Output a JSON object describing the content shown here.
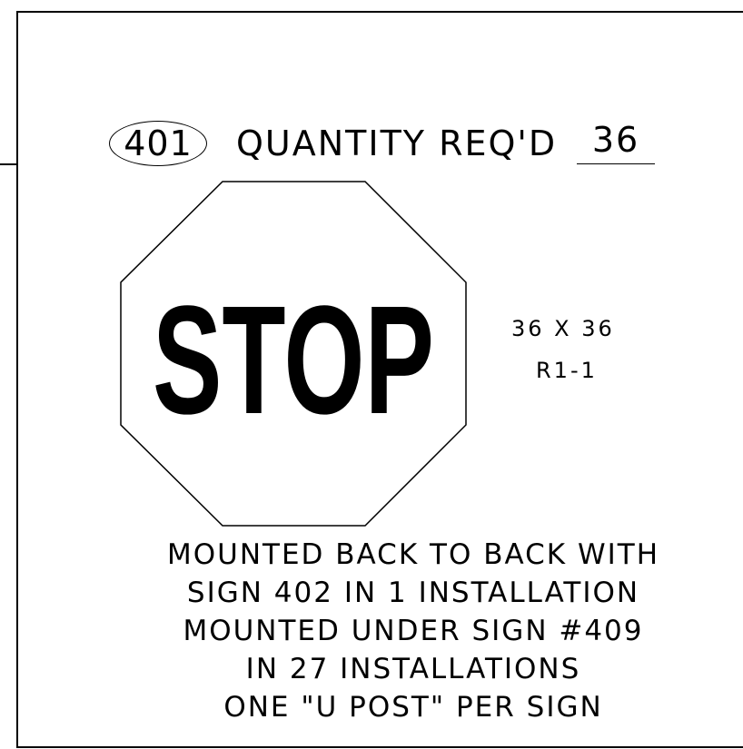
{
  "sign": {
    "number": "401",
    "quantity_label": "QUANTITY REQ'D",
    "quantity_value": "36",
    "legend": "STOP",
    "size": "36 X 36",
    "code": "R1-1",
    "shape": "octagon"
  },
  "notes": [
    "MOUNTED BACK TO BACK WITH",
    "SIGN 402 IN 1 INSTALLATION",
    "MOUNTED UNDER SIGN #409",
    "IN 27 INSTALLATIONS",
    "ONE \"U POST\" PER SIGN"
  ],
  "colors": {
    "line": "#000000",
    "background": "#ffffff"
  }
}
